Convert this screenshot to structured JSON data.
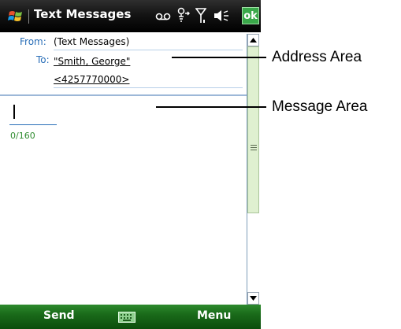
{
  "titlebar": {
    "title": "Text Messages",
    "icons": [
      "windows-flag-icon",
      "voicemail-icon",
      "connectivity-icon",
      "signal-icon",
      "volume-icon"
    ],
    "ok_label": "ok"
  },
  "message": {
    "from_label": "From:",
    "from_value": "(Text Messages)",
    "to_label": "To:",
    "to_name": "\"Smith, George\"",
    "to_number": "<4257770000>",
    "body_value": "",
    "counter": "0/160"
  },
  "softkeys": {
    "left": "Send",
    "center_icon": "keyboard-icon",
    "right": "Menu"
  },
  "callouts": {
    "address_area": "Address Area",
    "message_area": "Message Area"
  },
  "colors": {
    "titlebar": "#000000",
    "softkey_bar": "#1a6a1a",
    "label_blue": "#2a6fb8",
    "counter_green": "#2e8b2e",
    "ok_green": "#3aa84a"
  }
}
